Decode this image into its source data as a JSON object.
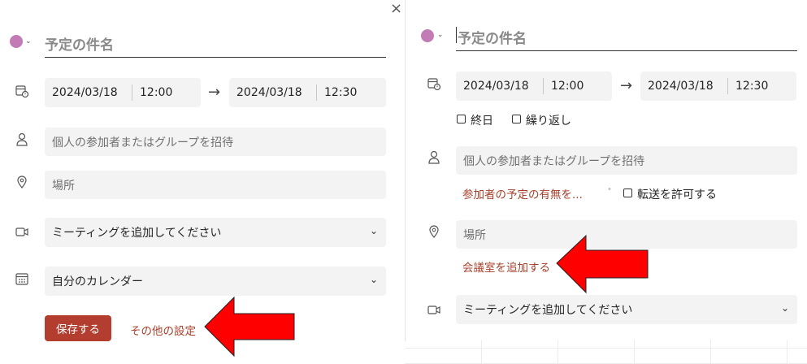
{
  "left_panel": {
    "close_label": "×",
    "title_placeholder": "予定の件名",
    "start_date": "2024/03/18",
    "start_time": "12:00",
    "arrow": "→",
    "end_date": "2024/03/18",
    "end_time": "12:30",
    "attendees_placeholder": "個人の参加者またはグループを招待",
    "location_placeholder": "場所",
    "meeting_select": "ミーティングを追加してください",
    "calendar_select": "自分のカレンダー",
    "save_label": "保存する",
    "more_settings_label": "その他の設定"
  },
  "right_panel": {
    "title_placeholder": "予定の件名",
    "start_date": "2024/03/18",
    "start_time": "12:00",
    "arrow": "→",
    "end_date": "2024/03/18",
    "end_time": "12:30",
    "all_day_label": "終日",
    "repeat_label": "繰り返し",
    "attendees_placeholder": "個人の参加者またはグループを招待",
    "attendee_status_link": "参加者の予定の有無を...",
    "allow_forward_label": "転送を許可する",
    "location_placeholder": "場所",
    "add_room_link": "会議室を追加する",
    "meeting_select": "ミーティングを追加してください"
  },
  "colors": {
    "event_color": "#c27bb5",
    "accent": "#b33e30",
    "link": "#a8402c",
    "annotation_arrow": "#ff0000"
  },
  "icons": {
    "chevron": "chevron-down-icon",
    "time": "calendar-clock-icon",
    "attendees": "person-icon",
    "location": "location-pin-icon",
    "video": "video-camera-icon",
    "calendar": "calendar-icon"
  }
}
